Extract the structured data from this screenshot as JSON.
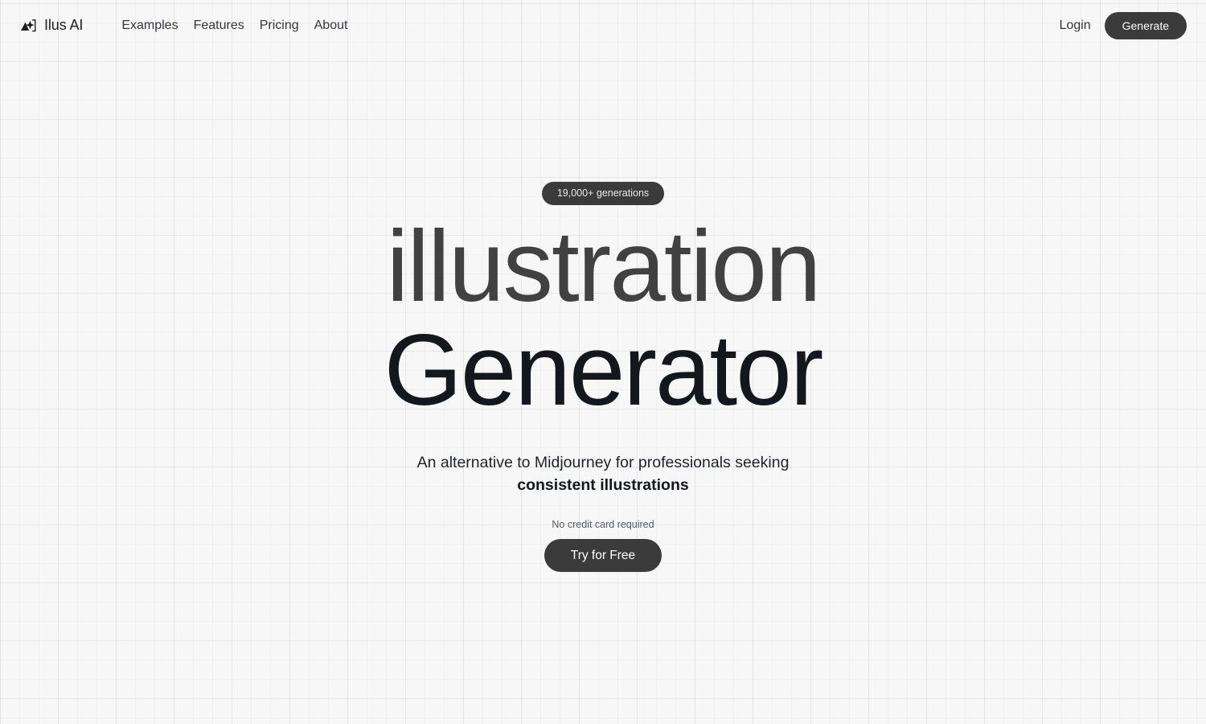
{
  "brand": {
    "name": "Ilus AI",
    "logo_icon": "mountain-sparkle-icon"
  },
  "nav": {
    "items": [
      {
        "label": "Examples"
      },
      {
        "label": "Features"
      },
      {
        "label": "Pricing"
      },
      {
        "label": "About"
      }
    ],
    "login_label": "Login",
    "generate_label": "Generate"
  },
  "hero": {
    "badge": "19,000+ generations",
    "title_line_1": "illustration",
    "title_line_2": "Generator",
    "subtitle_lead": "An alternative to Midjourney for professionals seeking",
    "subtitle_strong": "consistent illustrations",
    "cta_note": "No credit card required",
    "cta_label": "Try for Free"
  },
  "colors": {
    "page_background": "#f7f7f7",
    "dark_button": "#3b3b3b",
    "title_muted": "#414141",
    "title_strong": "#14181c",
    "nav_text": "#33363b",
    "note_text": "#555b66"
  }
}
